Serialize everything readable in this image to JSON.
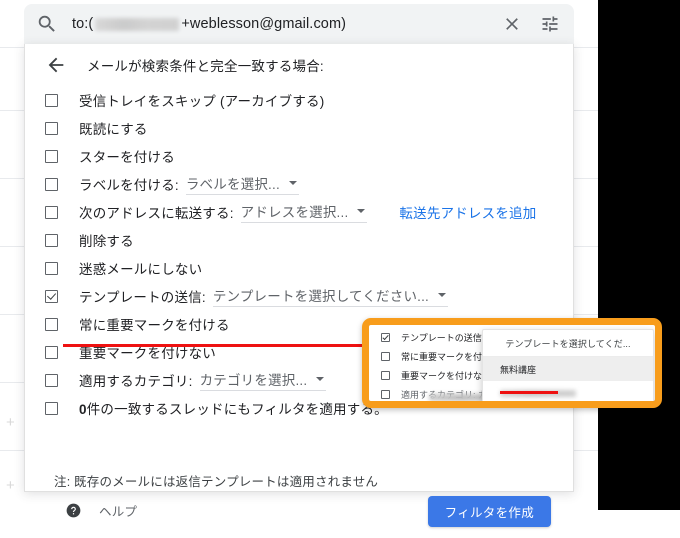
{
  "search": {
    "icon": "search-icon",
    "value_prefix": "to:(",
    "value_suffix": "+weblesson@gmail.com)",
    "redacted": true,
    "clear_icon": "close-icon",
    "options_icon": "tune-icon"
  },
  "panel": {
    "back_icon": "back-arrow-icon",
    "title": "メールが検索条件と完全一致する場合:",
    "options": [
      {
        "label": "受信トレイをスキップ (アーカイブする)",
        "checked": false
      },
      {
        "label": "既読にする",
        "checked": false
      },
      {
        "label": "スターを付ける",
        "checked": false
      },
      {
        "label": "ラベルを付ける:",
        "checked": false,
        "select": "ラベルを選択..."
      },
      {
        "label": "次のアドレスに転送する:",
        "checked": false,
        "select": "アドレスを選択...",
        "link": "転送先アドレスを追加"
      },
      {
        "label": "削除する",
        "checked": false
      },
      {
        "label": "迷惑メールにしない",
        "checked": false
      },
      {
        "label": "テンプレートの送信:",
        "checked": true,
        "select": "テンプレートを選択してください...",
        "annotated": true
      },
      {
        "label": "常に重要マークを付ける",
        "checked": false
      },
      {
        "label": "重要マークを付けない",
        "checked": false
      },
      {
        "label": "適用するカテゴリ:",
        "checked": false,
        "select": "カテゴリを選択..."
      },
      {
        "label_bold": "0",
        "label": "件の一致するスレッドにもフィルタを適用する。",
        "checked": false
      }
    ],
    "note": "注: 既存のメールには返信テンプレートは適用されません",
    "help_icon": "help-icon",
    "help_label": "ヘルプ",
    "create_button": "フィルタを作成"
  },
  "callout": {
    "border_color": "#f89d1c",
    "rows": [
      {
        "label": "テンプレートの送信:",
        "checked": true
      },
      {
        "label": "常に重要マークを付け",
        "checked": false
      },
      {
        "label": "重要マークを付けない",
        "checked": false
      },
      {
        "label": "適用するカテゴリ: カ",
        "checked": false
      }
    ],
    "dropdown": {
      "header": "テンプレートを選択してくだ...",
      "item_selected": "無料講座",
      "item_redacted": true,
      "annotated": true
    }
  },
  "colors": {
    "accent_blue": "#3b78e7",
    "link_blue": "#1a73e8",
    "annotation_red": "#ee1111",
    "callout_orange": "#f89d1c",
    "search_bg": "#f1f3f4"
  }
}
